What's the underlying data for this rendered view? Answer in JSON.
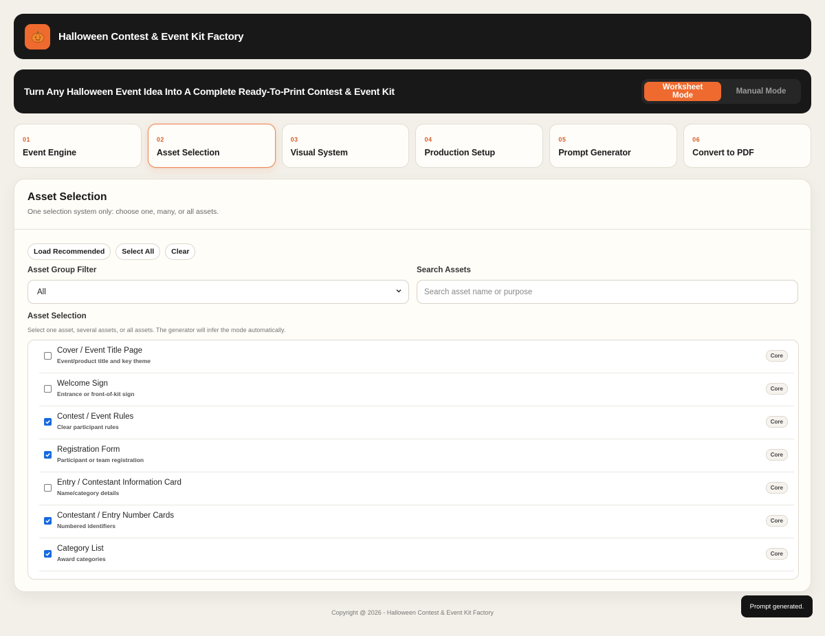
{
  "app": {
    "logo_icon": "pumpkin-icon",
    "title": "Halloween Contest & Event Kit Factory",
    "accent_color": "#ee6a2f"
  },
  "hero": {
    "title": "Turn Any Halloween Event Idea Into A Complete Ready-To-Print Contest & Event Kit",
    "modes": [
      {
        "label": "Worksheet Mode",
        "active": true
      },
      {
        "label": "Manual Mode",
        "active": false
      }
    ]
  },
  "steps": [
    {
      "num": "01",
      "label": "Event Engine",
      "active": false
    },
    {
      "num": "02",
      "label": "Asset Selection",
      "active": true
    },
    {
      "num": "03",
      "label": "Visual System",
      "active": false
    },
    {
      "num": "04",
      "label": "Production Setup",
      "active": false
    },
    {
      "num": "05",
      "label": "Prompt Generator",
      "active": false
    },
    {
      "num": "06",
      "label": "Convert to PDF",
      "active": false
    }
  ],
  "panel": {
    "title": "Asset Selection",
    "subtitle": "One selection system only: choose one, many, or all assets.",
    "buttons": {
      "load_recommended": "Load Recommended",
      "select_all": "Select All",
      "clear": "Clear"
    },
    "group_filter": {
      "label": "Asset Group Filter",
      "value": "All"
    },
    "search": {
      "label": "Search Assets",
      "placeholder": "Search asset name or purpose",
      "value": ""
    },
    "selection_label": "Asset Selection",
    "selection_hint": "Select one asset, several assets, or all assets. The generator will infer the mode automatically.",
    "assets": [
      {
        "name": "Cover / Event Title Page",
        "desc": "Event/product title and key theme",
        "checked": false,
        "badge": "Core"
      },
      {
        "name": "Welcome Sign",
        "desc": "Entrance or front-of-kit sign",
        "checked": false,
        "badge": "Core"
      },
      {
        "name": "Contest / Event Rules",
        "desc": "Clear participant rules",
        "checked": true,
        "badge": "Core"
      },
      {
        "name": "Registration Form",
        "desc": "Participant or team registration",
        "checked": true,
        "badge": "Core"
      },
      {
        "name": "Entry / Contestant Information Card",
        "desc": "Name/category details",
        "checked": false,
        "badge": "Core"
      },
      {
        "name": "Contestant / Entry Number Cards",
        "desc": "Numbered identifiers",
        "checked": true,
        "badge": "Core"
      },
      {
        "name": "Category List",
        "desc": "Award categories",
        "checked": true,
        "badge": "Core"
      }
    ]
  },
  "footer": {
    "copyright": "Copyright @ 2026 - Halloween Contest & Event Kit Factory"
  },
  "toast": {
    "message": "Prompt generated."
  }
}
